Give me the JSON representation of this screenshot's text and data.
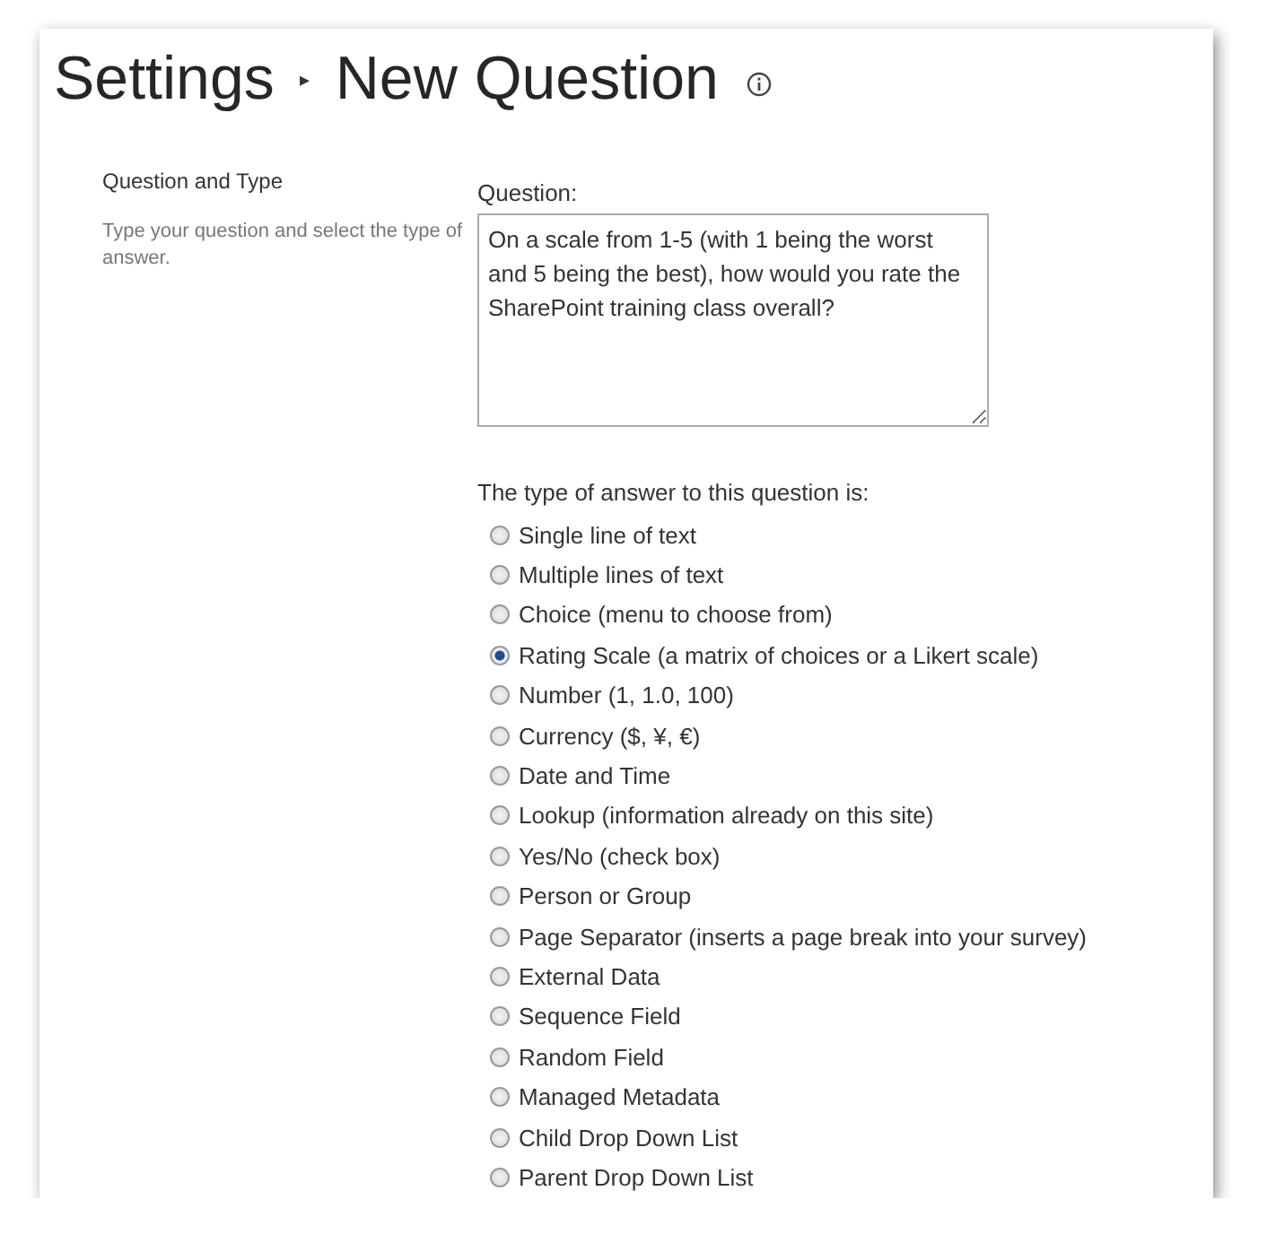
{
  "title": {
    "breadcrumb": "Settings",
    "separator": "▸",
    "page": "New Question"
  },
  "section": {
    "heading": "Question and Type",
    "description": "Type your question and select the type of answer."
  },
  "question": {
    "label": "Question:",
    "value": "On a scale from 1-5 (with 1 being the worst and 5 being the best), how would you rate the SharePoint training class overall?"
  },
  "answer_type": {
    "label": "The type of answer to this question is:",
    "options": [
      {
        "label": "Single line of text",
        "selected": false
      },
      {
        "label": "Multiple lines of text",
        "selected": false
      },
      {
        "label": "Choice (menu to choose from)",
        "selected": false
      },
      {
        "label": "Rating Scale (a matrix of choices or a Likert scale)",
        "selected": true
      },
      {
        "label": "Number (1, 1.0, 100)",
        "selected": false
      },
      {
        "label": "Currency ($, ¥, €)",
        "selected": false
      },
      {
        "label": "Date and Time",
        "selected": false
      },
      {
        "label": "Lookup (information already on this site)",
        "selected": false
      },
      {
        "label": "Yes/No (check box)",
        "selected": false
      },
      {
        "label": "Person or Group",
        "selected": false
      },
      {
        "label": "Page Separator (inserts a page break into your survey)",
        "selected": false
      },
      {
        "label": "External Data",
        "selected": false
      },
      {
        "label": "Sequence Field",
        "selected": false
      },
      {
        "label": "Random Field",
        "selected": false
      },
      {
        "label": "Managed Metadata",
        "selected": false
      },
      {
        "label": "Child Drop Down List",
        "selected": false
      },
      {
        "label": "Parent Drop Down List",
        "selected": false
      }
    ]
  }
}
